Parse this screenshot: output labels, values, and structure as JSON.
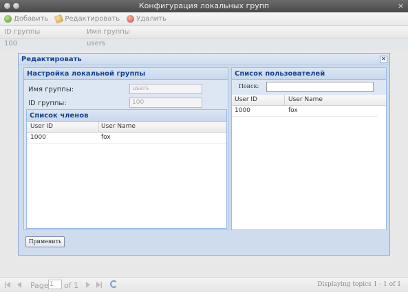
{
  "window": {
    "title": "Конфигурация локальных групп",
    "close_glyph": "×"
  },
  "toolbar": {
    "add_label": "Добавить",
    "edit_label": "Редактировать",
    "delete_label": "Удалить"
  },
  "groups_grid": {
    "columns": [
      "ID группы",
      "Имя группы"
    ],
    "rows": [
      {
        "id": "100",
        "name": "users"
      }
    ]
  },
  "modal": {
    "title": "Редактировать",
    "close_glyph": "×",
    "settings_panel": {
      "title": "Настройка локальной группы",
      "group_name_label": "Имя группы:",
      "group_name_value": "users",
      "group_id_label": "ID группы:",
      "group_id_value": "100"
    },
    "members": {
      "title": "Список членов",
      "columns": [
        "User ID",
        "User Name"
      ],
      "rows": [
        {
          "id": "1000",
          "name": "fox"
        }
      ]
    },
    "users": {
      "title": "Список пользователей",
      "search_label": "Поиск:",
      "search_value": "",
      "columns": [
        "User ID",
        "User Name"
      ],
      "rows": [
        {
          "id": "1000",
          "name": "fox"
        }
      ]
    },
    "apply_label": "Применить"
  },
  "pager": {
    "page_label": "Page",
    "page_value": "1",
    "of_label": "of 1",
    "displaying": "Displaying topics 1 - 1 of 1"
  },
  "colors": {
    "header_text": "#15428b",
    "panel_border": "#99bbe8"
  }
}
